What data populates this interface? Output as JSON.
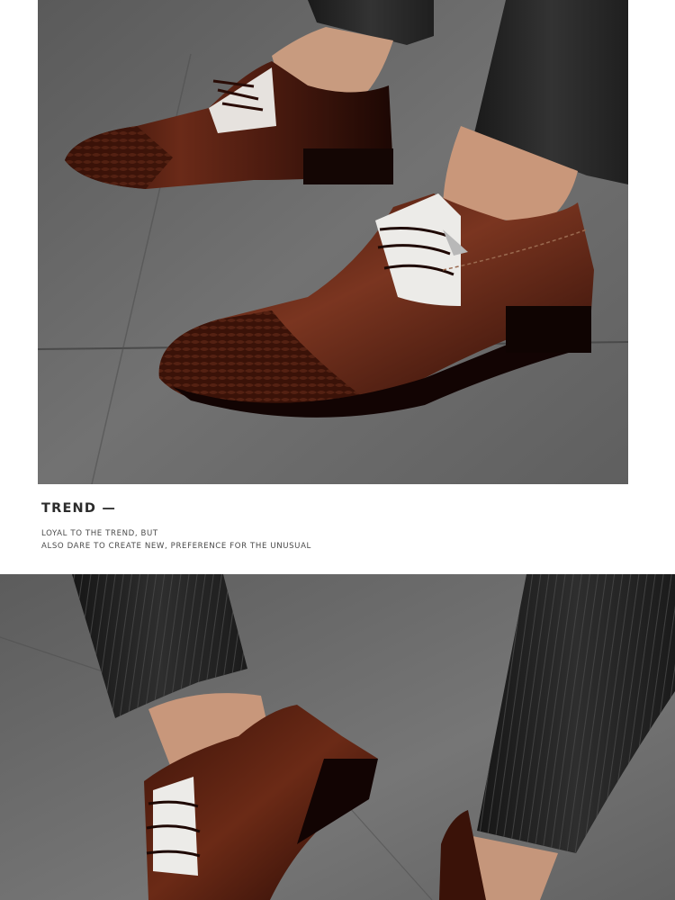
{
  "banner_top": {
    "subject": "brown-patent-leather-oxford-shoes-on-concrete"
  },
  "trend": {
    "title": "TREND —",
    "lines": [
      "LOYAL TO THE TREND, BUT",
      "ALSO DARE TO CREATE NEW, PREFERENCE FOR THE UNUSUAL"
    ]
  },
  "banner_bottom": {
    "subject": "brown-patent-leather-oxford-shoes-with-pinstripe-trousers"
  },
  "colors": {
    "concrete": "#6e6e6e",
    "leather": "#4a1d12",
    "trouser": "#242424",
    "text": "#2b2b2b"
  }
}
